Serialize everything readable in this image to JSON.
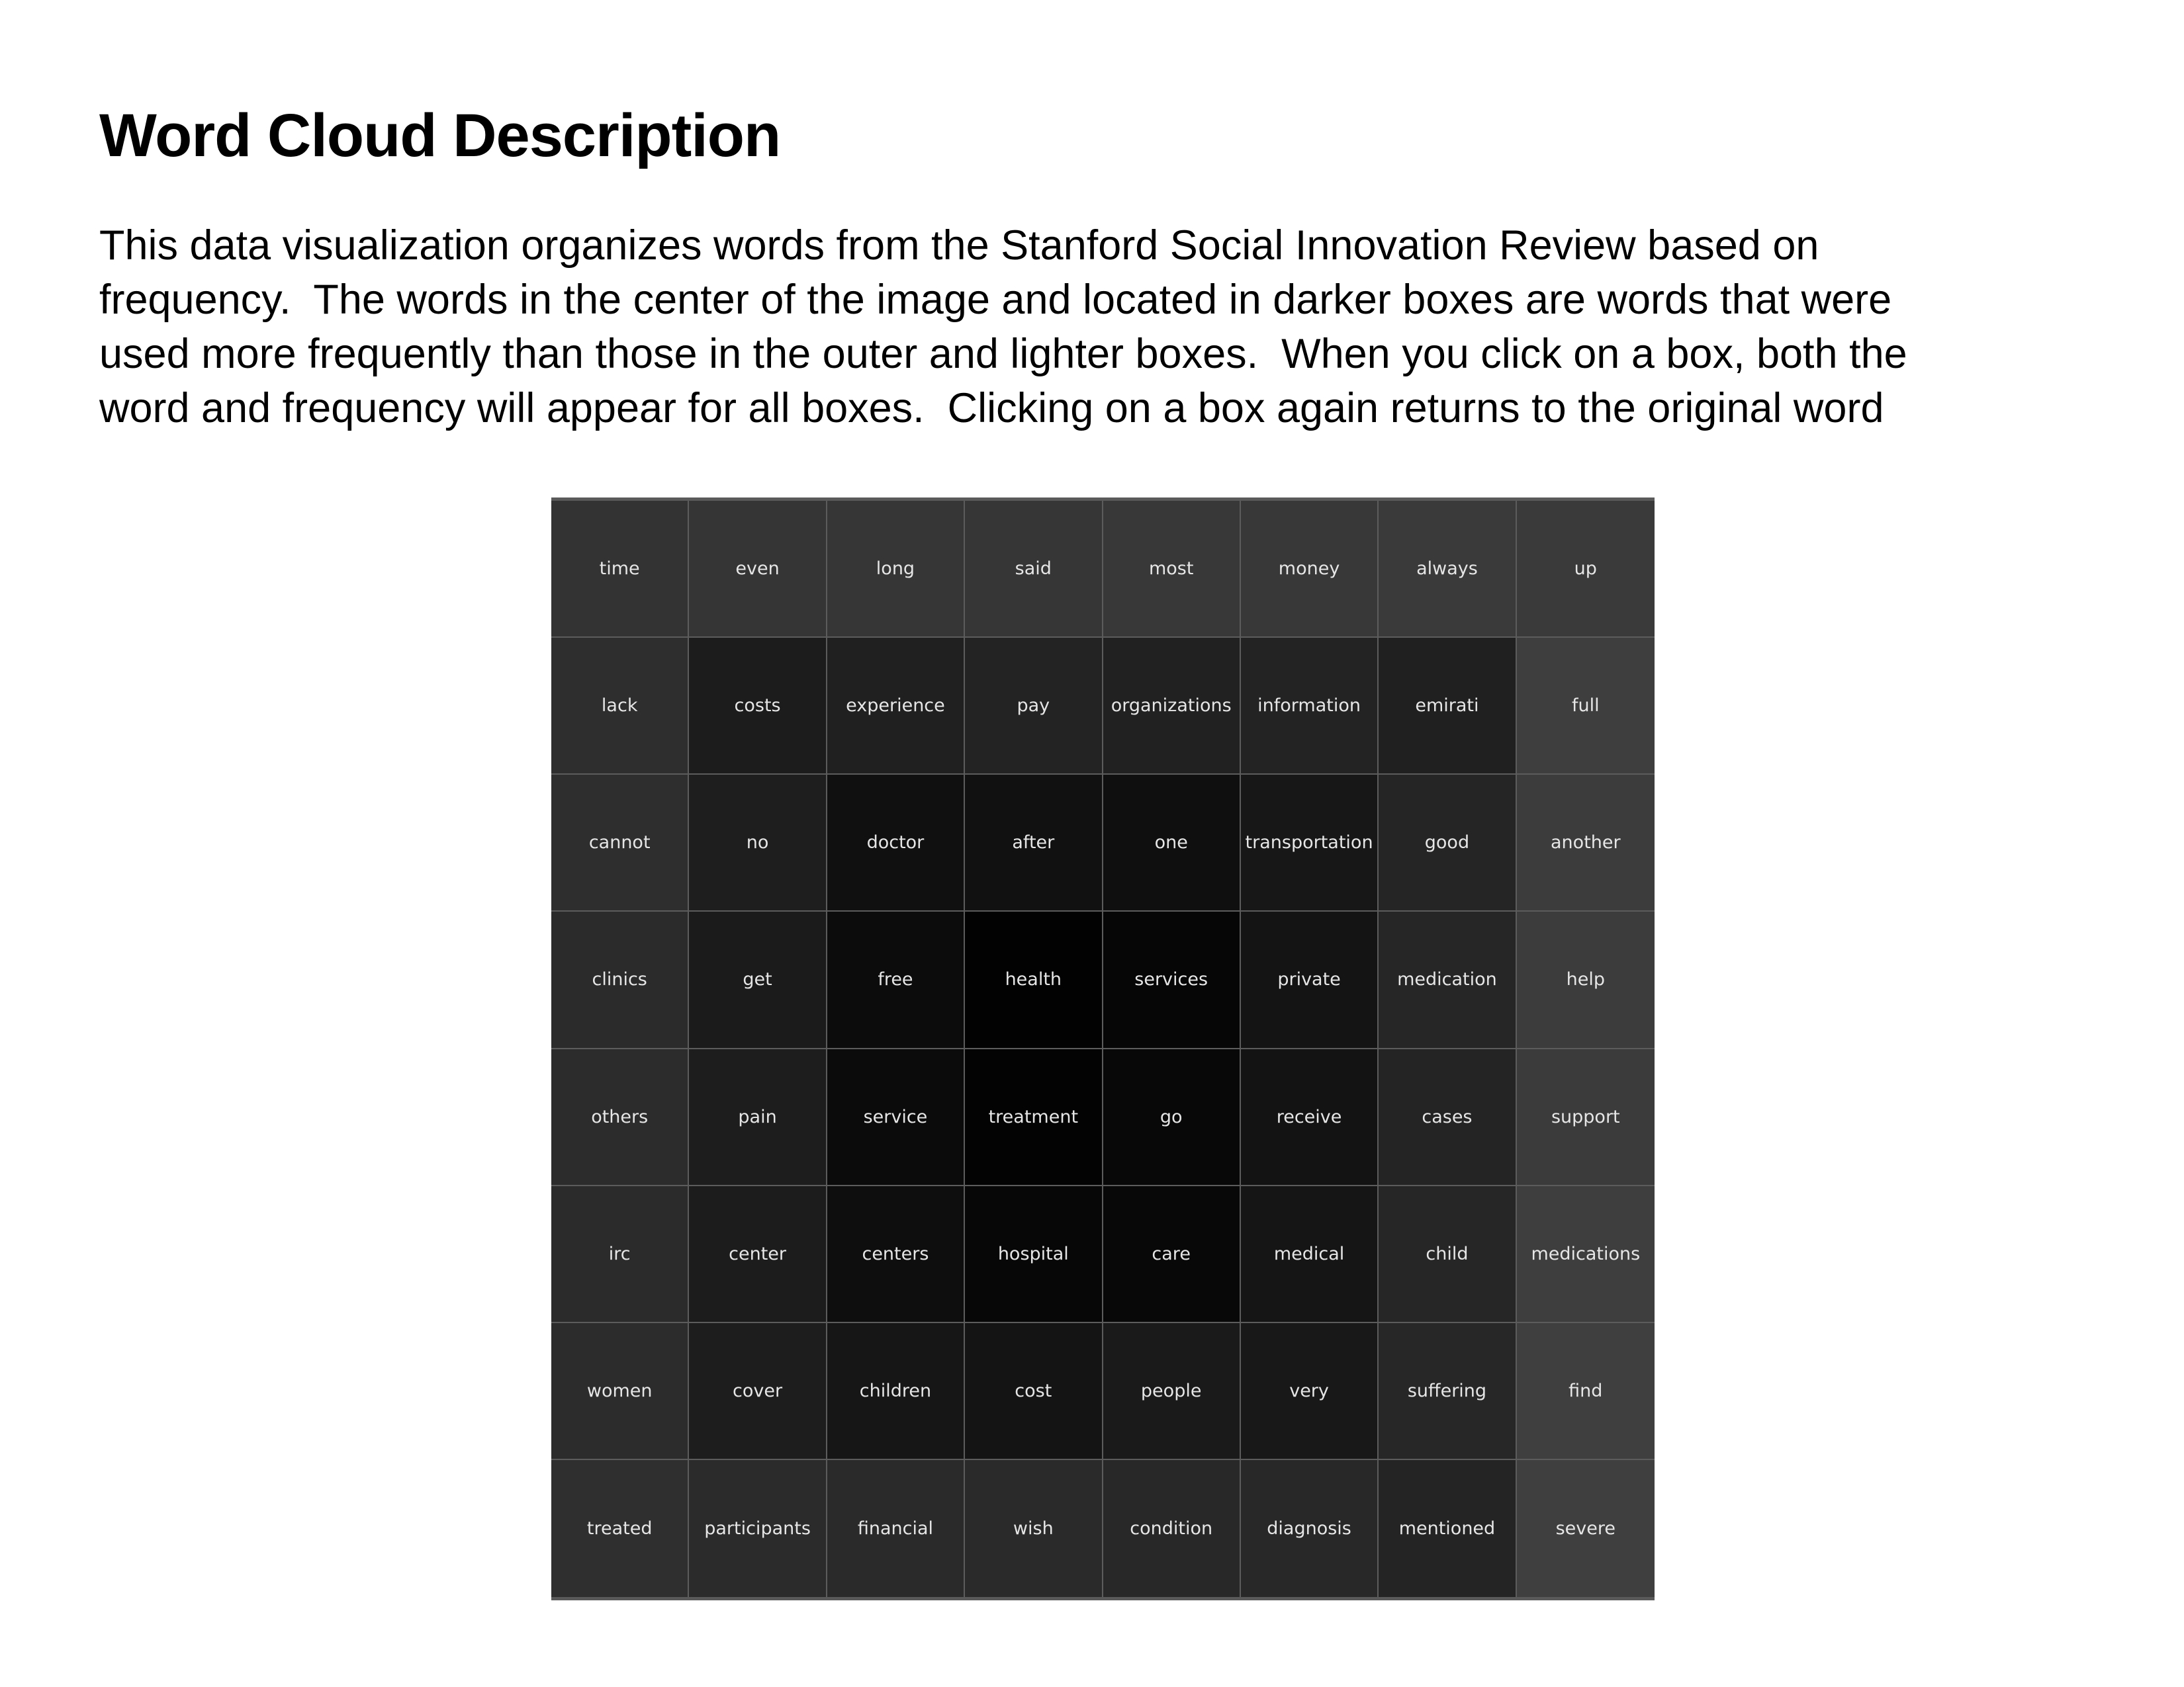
{
  "page": {
    "title": "Word Cloud Description",
    "description_lines": [
      "This data visualization organizes words from the Stanford Social Innovation Review based on",
      "frequency.  The words in the center of the image and located in darker boxes are words that were",
      "used more frequently than those in the outer and lighter boxes.  When you click on a box, both the",
      "word and frequency will appear for all boxes.  Clicking on a box again returns to the original word"
    ]
  },
  "word_grid": {
    "text_color": "#e6e6e6",
    "grid_line_color": "#5c5c5c",
    "rows": [
      [
        {
          "word": "time",
          "color": "#333333"
        },
        {
          "word": "even",
          "color": "#353535"
        },
        {
          "word": "long",
          "color": "#363636"
        },
        {
          "word": "said",
          "color": "#363636"
        },
        {
          "word": "most",
          "color": "#383838"
        },
        {
          "word": "money",
          "color": "#383838"
        },
        {
          "word": "always",
          "color": "#3a3a3a"
        },
        {
          "word": "up",
          "color": "#3a3a3a"
        }
      ],
      [
        {
          "word": "lack",
          "color": "#2e2e2e"
        },
        {
          "word": "costs",
          "color": "#1c1c1c"
        },
        {
          "word": "experience",
          "color": "#202020"
        },
        {
          "word": "pay",
          "color": "#232323"
        },
        {
          "word": "organizations",
          "color": "#212121"
        },
        {
          "word": "information",
          "color": "#232323"
        },
        {
          "word": "emirati",
          "color": "#202020"
        },
        {
          "word": "full",
          "color": "#3e3e3e"
        }
      ],
      [
        {
          "word": "cannot",
          "color": "#2e2e2e"
        },
        {
          "word": "no",
          "color": "#1e1e1e"
        },
        {
          "word": "doctor",
          "color": "#101010"
        },
        {
          "word": "after",
          "color": "#111111"
        },
        {
          "word": "one",
          "color": "#0f0f0f"
        },
        {
          "word": "transportation",
          "color": "#171717"
        },
        {
          "word": "good",
          "color": "#252525"
        },
        {
          "word": "another",
          "color": "#3c3c3c"
        }
      ],
      [
        {
          "word": "clinics",
          "color": "#2b2b2b"
        },
        {
          "word": "get",
          "color": "#1b1b1b"
        },
        {
          "word": "free",
          "color": "#0c0c0c"
        },
        {
          "word": "health",
          "color": "#020202"
        },
        {
          "word": "services",
          "color": "#060606"
        },
        {
          "word": "private",
          "color": "#141414"
        },
        {
          "word": "medication",
          "color": "#262626"
        },
        {
          "word": "help",
          "color": "#3c3c3c"
        }
      ],
      [
        {
          "word": "others",
          "color": "#2c2c2c"
        },
        {
          "word": "pain",
          "color": "#1d1d1d"
        },
        {
          "word": "service",
          "color": "#0b0b0b"
        },
        {
          "word": "treatment",
          "color": "#030303"
        },
        {
          "word": "go",
          "color": "#080808"
        },
        {
          "word": "receive",
          "color": "#131313"
        },
        {
          "word": "cases",
          "color": "#242424"
        },
        {
          "word": "support",
          "color": "#3b3b3b"
        }
      ],
      [
        {
          "word": "irc",
          "color": "#2b2b2b"
        },
        {
          "word": "center",
          "color": "#1c1c1c"
        },
        {
          "word": "centers",
          "color": "#0e0e0e"
        },
        {
          "word": "hospital",
          "color": "#070707"
        },
        {
          "word": "care",
          "color": "#080808"
        },
        {
          "word": "medical",
          "color": "#151515"
        },
        {
          "word": "child",
          "color": "#262626"
        },
        {
          "word": "medications",
          "color": "#3e3e3e"
        }
      ],
      [
        {
          "word": "women",
          "color": "#2c2c2c"
        },
        {
          "word": "cover",
          "color": "#1d1d1d"
        },
        {
          "word": "children",
          "color": "#161616"
        },
        {
          "word": "cost",
          "color": "#141414"
        },
        {
          "word": "people",
          "color": "#1a1a1a"
        },
        {
          "word": "very",
          "color": "#181818"
        },
        {
          "word": "suffering",
          "color": "#272727"
        },
        {
          "word": "find",
          "color": "#3f3f3f"
        }
      ],
      [
        {
          "word": "treated",
          "color": "#2f2f2f"
        },
        {
          "word": "participants",
          "color": "#2b2b2b"
        },
        {
          "word": "financial",
          "color": "#2a2a2a"
        },
        {
          "word": "wish",
          "color": "#2a2a2a"
        },
        {
          "word": "condition",
          "color": "#282828"
        },
        {
          "word": "diagnosis",
          "color": "#282828"
        },
        {
          "word": "mentioned",
          "color": "#242424"
        },
        {
          "word": "severe",
          "color": "#3f3f3f"
        }
      ]
    ]
  }
}
